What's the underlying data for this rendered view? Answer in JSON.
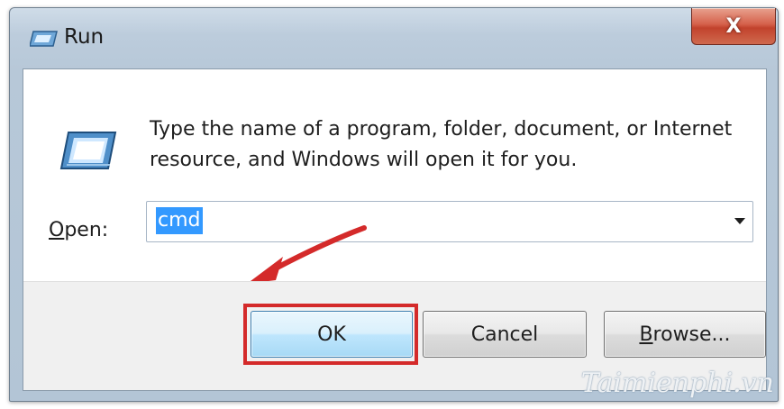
{
  "window": {
    "title": "Run",
    "close_glyph": "X",
    "title_icon": "run-icon"
  },
  "content": {
    "big_icon": "run-icon",
    "description": "Type the name of a program, folder, document, or Internet resource, and Windows will open it for you.",
    "open_label_underlined": "O",
    "open_label_rest": "pen:",
    "open_value": "cmd"
  },
  "buttons": {
    "ok": "OK",
    "cancel": "Cancel",
    "browse_underlined": "B",
    "browse_rest": "rowse..."
  },
  "annotations": {
    "arrow_color": "#d42a2a",
    "highlight_color": "#d42a2a"
  },
  "watermark": "Taimienphi.vn"
}
